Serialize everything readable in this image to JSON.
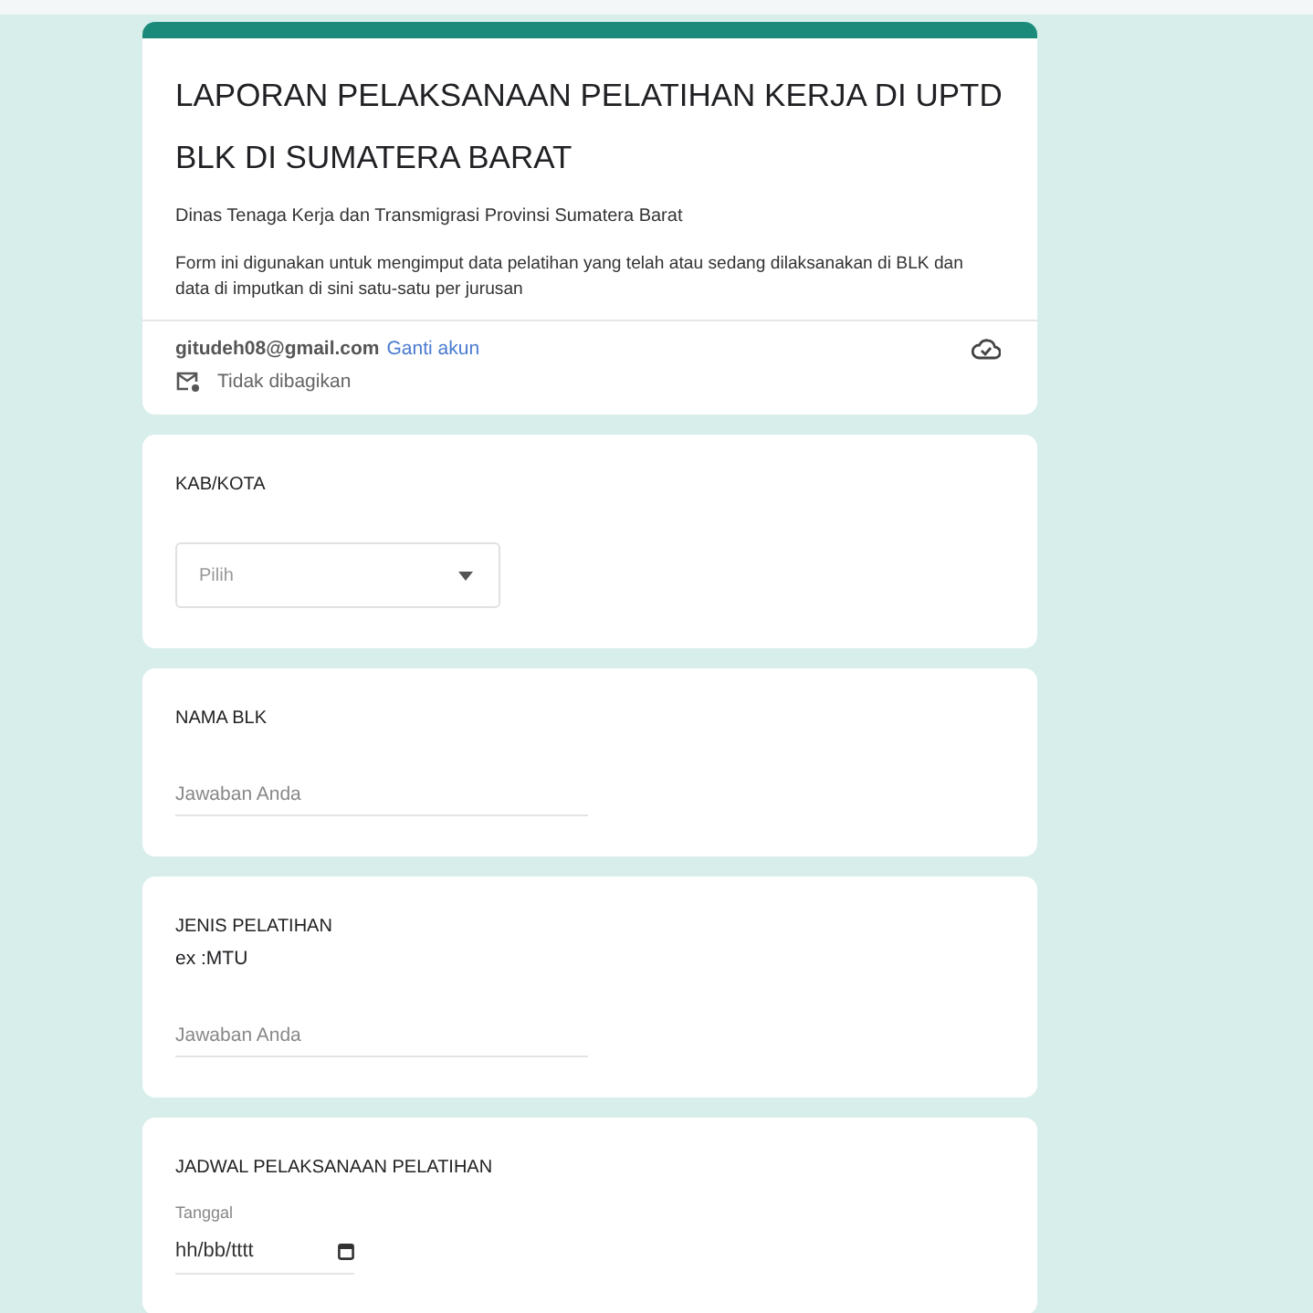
{
  "header": {
    "title": "LAPORAN PELAKSANAAN PELATIHAN KERJA DI UPTD BLK DI SUMATERA BARAT",
    "subtitle": "Dinas Tenaga Kerja dan Transmigrasi Provinsi Sumatera Barat",
    "description": "Form ini digunakan untuk mengimput data pelatihan yang telah atau sedang dilaksanakan di BLK dan data di imputkan di sini satu-satu  per jurusan",
    "email": "gitudeh08@gmail.com",
    "switch_account": "Ganti akun",
    "sharing": "Tidak dibagikan"
  },
  "questions": [
    {
      "kind": "dropdown",
      "label": "KAB/KOTA",
      "placeholder": "Pilih"
    },
    {
      "kind": "text",
      "label": "NAMA BLK",
      "placeholder": "Jawaban Anda"
    },
    {
      "kind": "text",
      "label": "JENIS PELATIHAN",
      "hint": "ex :MTU",
      "placeholder": "Jawaban Anda"
    },
    {
      "kind": "date",
      "label": "JADWAL PELAKSANAAN PELATIHAN",
      "sublabel": "Tanggal",
      "placeholder": "hh/bb/tttt"
    }
  ]
}
